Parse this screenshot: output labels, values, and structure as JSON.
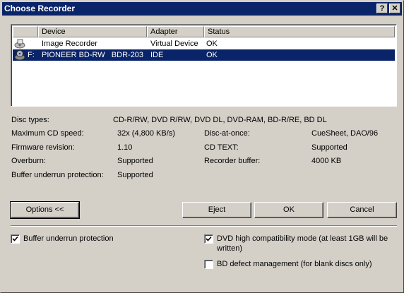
{
  "window": {
    "title": "Choose Recorder",
    "help_label": "?",
    "close_label": "✕"
  },
  "list": {
    "columns": [
      "Device",
      "Adapter",
      "Status"
    ],
    "rows": [
      {
        "drive": "",
        "device": "Image Recorder",
        "adapter": "Virtual Device",
        "status": "OK",
        "icon": "image-recorder-icon",
        "selected": false
      },
      {
        "drive": "F:",
        "device": "PIONEER BD-RW   BDR-203",
        "adapter": "IDE",
        "status": "OK",
        "icon": "optical-drive-icon",
        "selected": true
      }
    ]
  },
  "info": {
    "disc_types_label": "Disc types:",
    "disc_types_value": "CD-R/RW, DVD R/RW, DVD DL, DVD-RAM, BD-R/RE, BD DL",
    "max_cd_speed_label": "Maximum CD speed:",
    "max_cd_speed_value": "32x (4,800 KB/s)",
    "firmware_label": "Firmware revision:",
    "firmware_value": "1.10",
    "overburn_label": "Overburn:",
    "overburn_value": "Supported",
    "buffer_underrun_label": "Buffer underrun protection:",
    "buffer_underrun_value": "Supported",
    "dao_label": "Disc-at-once:",
    "dao_value": "CueSheet, DAO/96",
    "cdtext_label": "CD TEXT:",
    "cdtext_value": "Supported",
    "recorder_buffer_label": "Recorder buffer:",
    "recorder_buffer_value": "4000 KB"
  },
  "buttons": {
    "options": "Options <<",
    "eject": "Eject",
    "ok": "OK",
    "cancel": "Cancel"
  },
  "options": {
    "buffer_underrun": {
      "label": "Buffer underrun protection",
      "checked": true
    },
    "dvd_high_compat": {
      "label_line1": "DVD high compatibility mode (at least 1GB will be",
      "label_line2": "written)",
      "checked": true
    },
    "bd_defect": {
      "label": "BD defect management (for blank discs only)",
      "checked": false
    }
  }
}
